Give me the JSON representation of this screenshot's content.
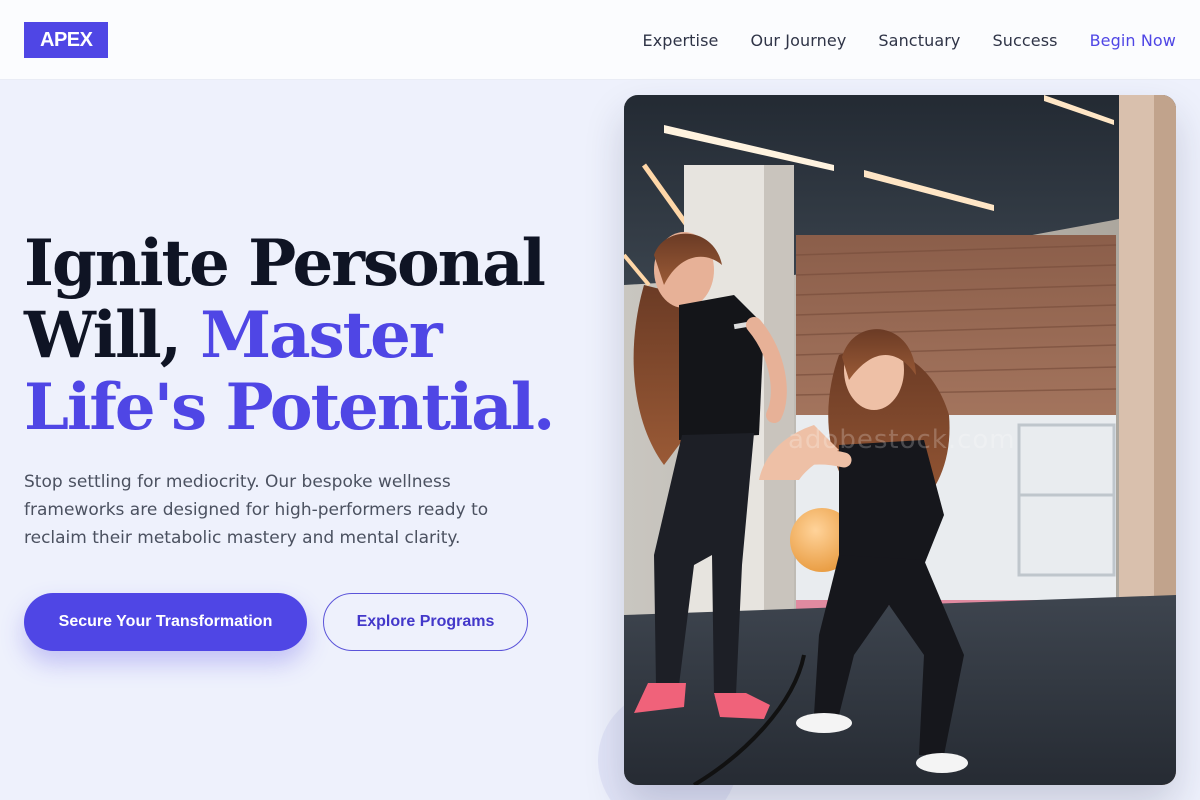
{
  "brand": {
    "logo_text": "APEX",
    "accent_color": "#4f46e5"
  },
  "nav": {
    "items": [
      {
        "label": "Expertise"
      },
      {
        "label": "Our Journey"
      },
      {
        "label": "Sanctuary"
      },
      {
        "label": "Success"
      }
    ],
    "cta_label": "Begin Now"
  },
  "hero": {
    "headline": {
      "line1": "Ignite Personal",
      "line2_part1": "Will,",
      "line2_part2": "Master",
      "line3": "Life's Potential."
    },
    "subtext": "Stop settling for mediocrity. Our bespoke wellness frameworks are designed for high-performers ready to reclaim their metabolic mastery and mental clarity.",
    "primary_button": "Secure Your Transformation",
    "secondary_button": "Explore Programs",
    "image": {
      "watermark": "adobestock.com"
    }
  }
}
